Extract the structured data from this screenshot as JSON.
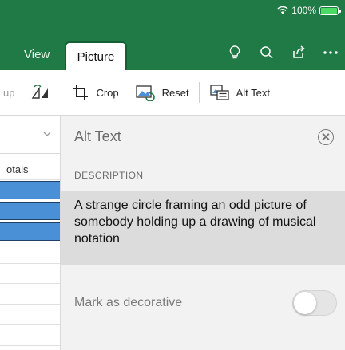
{
  "status": {
    "battery_percent": "100%"
  },
  "ribbon": {
    "tabs": [
      {
        "label": "View"
      },
      {
        "label": "Picture"
      }
    ]
  },
  "toolbar": {
    "group_label": "up",
    "crop_label": "Crop",
    "reset_label": "Reset",
    "alt_text_label": "Alt Text"
  },
  "sheet": {
    "column_label": "otals"
  },
  "alt_text_panel": {
    "title": "Alt Text",
    "description_header": "DESCRIPTION",
    "description_value": "A strange circle framing an odd picture of somebody holding up a drawing of musical notation",
    "decorative_label": "Mark as decorative",
    "decorative_on": false
  },
  "colors": {
    "ribbon_green": "#1f7a45",
    "panel_bg": "#f2f2f2",
    "selected_cell_blue": "#4a90d6"
  }
}
